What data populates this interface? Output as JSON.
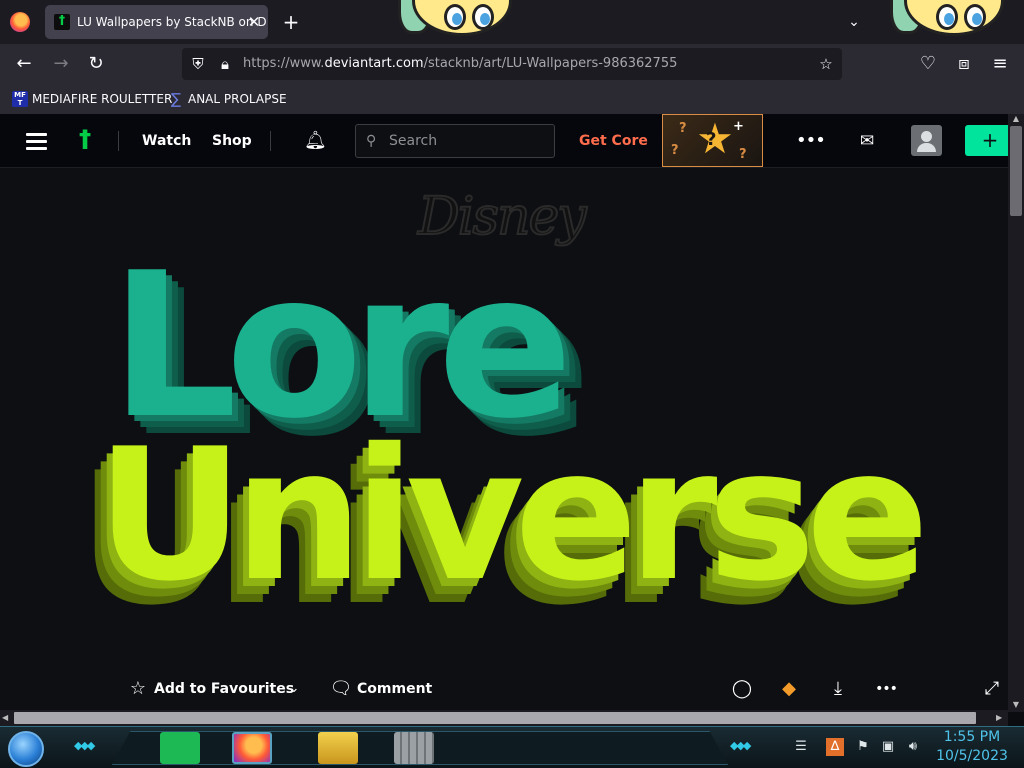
{
  "browser": {
    "tab_title": "LU Wallpapers by StackNB on D",
    "tab_close": "✕",
    "new_tab": "+",
    "tab_list": "⌄",
    "url_prefix": "https://www.",
    "url_domain": "deviantart.com",
    "url_path": "/stacknb/art/LU-Wallpapers-986362755"
  },
  "bookmarks": [
    {
      "label": "MEDIAFIRE ROULETTER",
      "icon": "mediafire-icon",
      "icon_text": "MF\nT"
    },
    {
      "label": "ANAL PROLAPSE",
      "icon": "bookmark-icon"
    }
  ],
  "header": {
    "watch": "Watch",
    "shop": "Shop",
    "search_placeholder": "Search",
    "get_core": "Get Core",
    "accent": "#00e59b",
    "core_color": "#ff6d4c"
  },
  "artwork": {
    "brand": "Disney",
    "line1": "Lore",
    "line2": "Universe"
  },
  "actions": {
    "favourite": "Add to Favourites",
    "comment": "Comment"
  },
  "taskbar": {
    "time": "1:55 PM",
    "date": "10/5/2023"
  }
}
